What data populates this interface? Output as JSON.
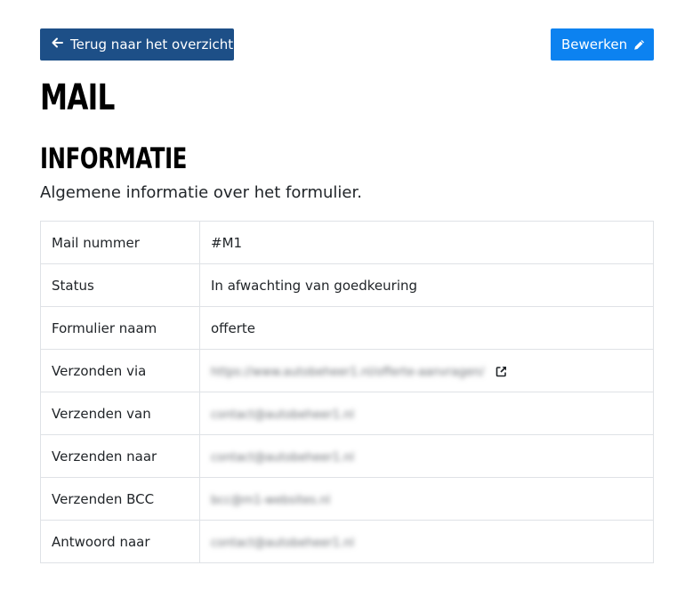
{
  "header": {
    "back_button_label": "Terug naar het overzicht",
    "back_icon": "arrow-left-icon",
    "edit_button_label": "Bewerken",
    "edit_icon": "pencil-icon"
  },
  "page_title": "MAIL",
  "section": {
    "title": "INFORMATIE",
    "subtitle": "Algemene informatie over het formulier."
  },
  "table": {
    "rows": [
      {
        "label": "Mail nummer",
        "value": "#M1"
      },
      {
        "label": "Status",
        "value": "In afwachting van goedkeuring"
      },
      {
        "label": "Formulier naam",
        "value": "offerte"
      },
      {
        "label": "Verzonden via",
        "value": "https://www.autobeheer1.nl/offerte-aanvragen/"
      },
      {
        "label": "Verzenden van",
        "value": "contact@autobeheer1.nl"
      },
      {
        "label": "Verzenden naar",
        "value": "contact@autobeheer1.nl"
      },
      {
        "label": "Verzenden BCC",
        "value": "bcc@m1-websites.nl"
      },
      {
        "label": "Antwoord naar",
        "value": "contact@autobeheer1.nl"
      }
    ]
  },
  "colors": {
    "back_button": "#1d4f87",
    "edit_button": "#0c82f0",
    "border": "#dfe2e6"
  }
}
